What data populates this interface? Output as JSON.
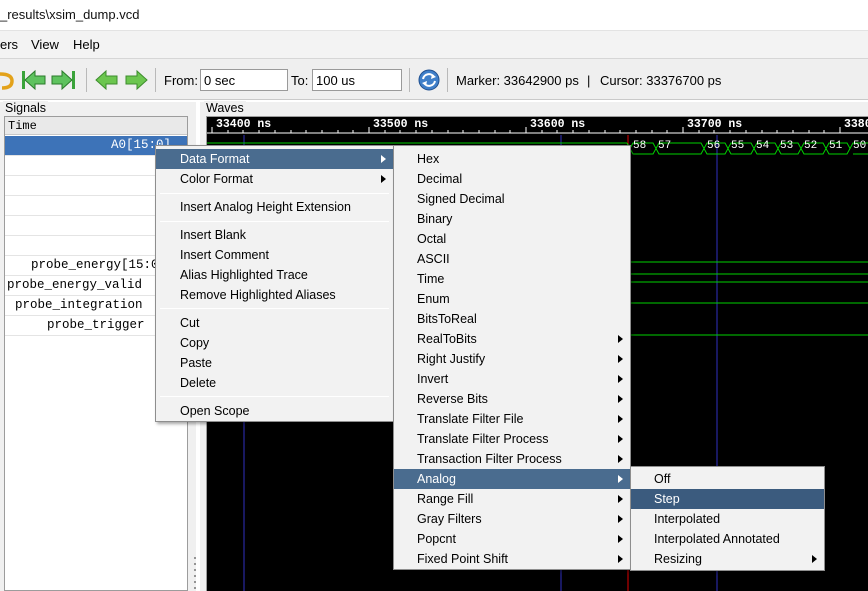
{
  "window": {
    "title": "_results\\xsim_dump.vcd"
  },
  "menubar": {
    "items": [
      "ers",
      "View",
      "Help"
    ]
  },
  "toolbar": {
    "from_label": "From:",
    "from_value": "0 sec",
    "to_label": "To:",
    "to_value": "100 us",
    "marker_label": "Marker: 33642900 ps",
    "separator": "|",
    "cursor_label": "Cursor: 33376700 ps"
  },
  "signals": {
    "caption": "Signals",
    "header": "Time",
    "rows": [
      "A0[15:0]",
      "",
      "",
      "",
      "",
      "",
      "probe_energy[15:0]",
      "probe_energy_valid",
      "probe_integration",
      "probe_trigger"
    ]
  },
  "waves": {
    "caption": "Waves",
    "ruler": [
      "33400 ns",
      "33500 ns",
      "33600 ns",
      "33700 ns",
      "3380"
    ],
    "bus_values": [
      "58",
      "57",
      "56",
      "55",
      "54",
      "53",
      "52",
      "51",
      "50"
    ]
  },
  "context_menu": {
    "items": [
      "Data Format",
      "Color Format",
      "Insert Analog Height Extension",
      "Insert Blank",
      "Insert Comment",
      "Alias Highlighted Trace",
      "Remove Highlighted Aliases",
      "Cut",
      "Copy",
      "Paste",
      "Delete",
      "Open Scope"
    ]
  },
  "format_submenu": {
    "items": [
      "Hex",
      "Decimal",
      "Signed Decimal",
      "Binary",
      "Octal",
      "ASCII",
      "Time",
      "Enum",
      "BitsToReal",
      "RealToBits",
      "Right Justify",
      "Invert",
      "Reverse Bits",
      "Translate Filter File",
      "Translate Filter Process",
      "Transaction Filter Process",
      "Analog",
      "Range Fill",
      "Gray Filters",
      "Popcnt",
      "Fixed Point Shift"
    ]
  },
  "analog_submenu": {
    "items": [
      "Off",
      "Step",
      "Interpolated",
      "Interpolated Annotated",
      "Resizing"
    ]
  },
  "colors": {
    "menu_highlight": "#4a6c8f",
    "selection": "#3d73b8",
    "wave_background": "#000000",
    "trace_green": "#00d000",
    "cursor_red": "#e00000",
    "marker_blue": "#3030c0"
  }
}
